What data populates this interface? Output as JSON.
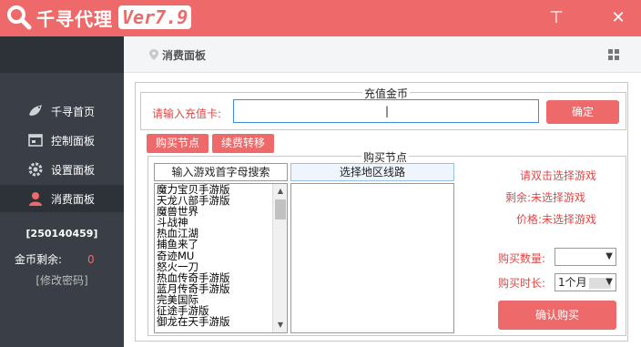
{
  "app": {
    "name": "千寻代理",
    "version": "Ver7.9",
    "colors": {
      "accent": "#ee6a6a",
      "sidebar": "#3a3f47",
      "sidebar_dark": "#2d3238"
    }
  },
  "window": {
    "minimize_glyph": "⊤",
    "close_glyph": "✕"
  },
  "sidebar": {
    "items": [
      {
        "label": "千寻首页",
        "icon": "bird-icon"
      },
      {
        "label": "控制面板",
        "icon": "panel-icon"
      },
      {
        "label": "设置面板",
        "icon": "gear-icon"
      },
      {
        "label": "消费面板",
        "icon": "user-icon"
      }
    ],
    "account_id": "[250140459]",
    "coins_label": "金币剩余:",
    "coins_value": "0",
    "change_password": "[修改密码]"
  },
  "header": {
    "title": "消费面板"
  },
  "recharge": {
    "legend": "充值金币",
    "label": "请输入充值卡:",
    "input_value": "|",
    "confirm": "确定"
  },
  "tabs": [
    "购买节点",
    "续费转移"
  ],
  "purchase": {
    "legend": "购买节点",
    "search_label": "输入游戏首字母搜索",
    "region_label": "选择地区线路",
    "games": [
      "魔力宝贝手游版",
      "天龙八部手游版",
      "魔兽世界",
      "斗战神",
      "热血江湖",
      "捕鱼来了",
      "奇迹MU",
      "怒火一刀",
      "热血传奇手游版",
      "蓝月传奇手游版",
      "完美国际",
      "征途手游版",
      "御龙在天手游版"
    ],
    "hint": "请双击选择游戏",
    "remain": "剩余:未选择游戏",
    "price": "价格:未选择游戏",
    "qty_label": "购买数量:",
    "qty_value": "",
    "duration_label": "购买时长:",
    "duration_value": "1个月",
    "buy": "确认购买"
  }
}
